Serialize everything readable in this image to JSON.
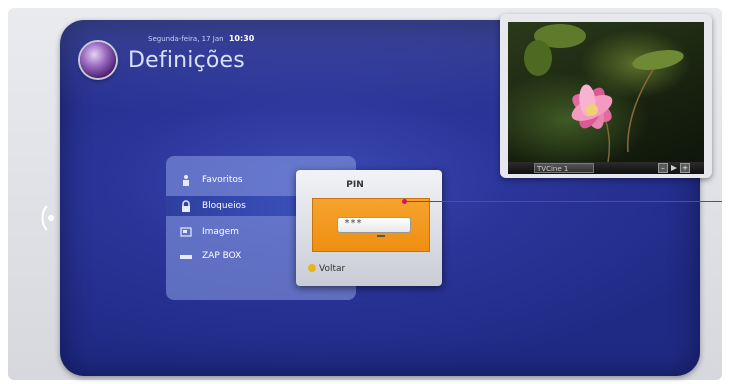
{
  "header": {
    "date": "Segunda-feira, 17 Jan",
    "time": "10:30",
    "title": "Definições"
  },
  "preview": {
    "channel": "TVCine 1",
    "minus_label": "–",
    "plus_label": "+"
  },
  "menu": {
    "items": [
      {
        "label": "Favoritos",
        "icon": "favorites-icon"
      },
      {
        "label": "Bloqueios",
        "icon": "lock-icon"
      },
      {
        "label": "Imagem",
        "icon": "image-icon"
      },
      {
        "label": "ZAP BOX",
        "icon": "zapbox-icon"
      }
    ],
    "selected_index": 1
  },
  "pin_dialog": {
    "title": "PIN",
    "value": "***",
    "back_label": "Voltar"
  },
  "colors": {
    "panel_blue": "#2b3599",
    "highlight_orange": "#f09a1f",
    "callout_magenta": "#d0136b"
  }
}
